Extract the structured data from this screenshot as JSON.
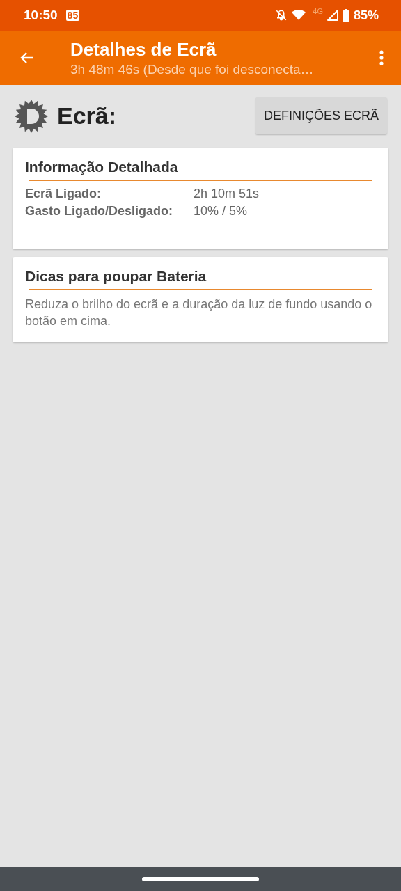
{
  "status_bar": {
    "time": "10:50",
    "notification_badge": "85",
    "network": "4G",
    "battery": "85%"
  },
  "app_bar": {
    "title": "Detalhes de Ecrã",
    "subtitle": "3h 48m 46s (Desde que foi desconecta…"
  },
  "header": {
    "title": "Ecrã:",
    "button": "DEFINIÇÕES ECRÃ"
  },
  "cards": [
    {
      "kind": "table",
      "title": "Informação Detalhada",
      "rows": [
        {
          "label": "Ecrã Ligado:",
          "value": "2h 10m 51s"
        },
        {
          "label": "Gasto Ligado/Desligado:",
          "value": "10% / 5%"
        }
      ]
    },
    {
      "kind": "text",
      "title": "Dicas para poupar Bateria",
      "text": "Reduza o brilho do ecrã e a duração da luz de fundo usando o botão em cima."
    }
  ]
}
